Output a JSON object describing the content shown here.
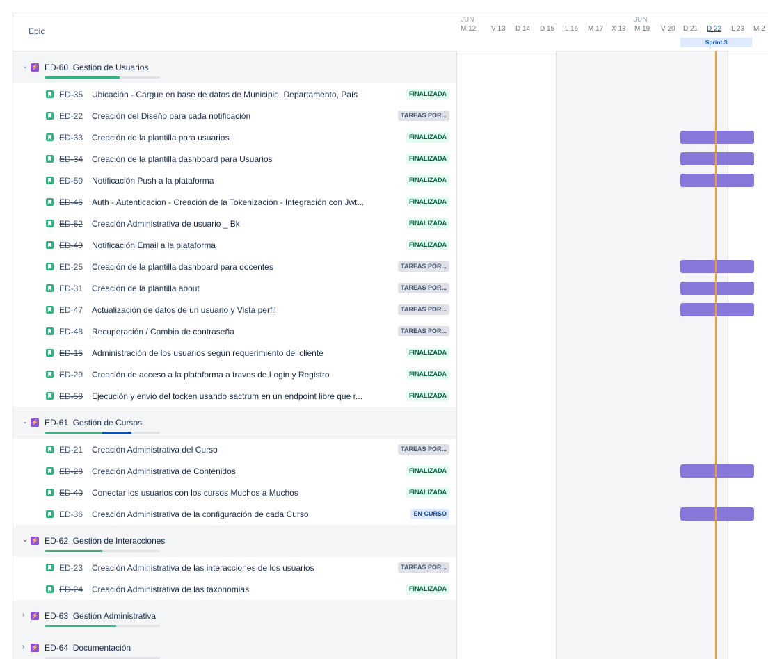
{
  "header": {
    "epic_label": "Epic",
    "months": [
      "JUN",
      "JUN"
    ],
    "days": [
      "M 12",
      "V 13",
      "D 14",
      "D 15",
      "L 16",
      "M 17",
      "X 18",
      "M 19",
      "V 20",
      "D 21",
      "D 22",
      "L 23",
      "M 2"
    ],
    "sprint": "Sprint 3"
  },
  "colors": {
    "epic": "#904ee2",
    "story": "#36b37e",
    "bar": "#8777d9",
    "today": "#ff991f",
    "progress_done": "#36b37e",
    "progress_inprogress": "#0052cc"
  },
  "rows": [
    {
      "type": "epic",
      "expanded": true,
      "key": "ED-60",
      "title": "Gestión de Usuarios",
      "progress": {
        "done": 0.65,
        "inprogress": 0
      }
    },
    {
      "type": "story",
      "key": "ED-35",
      "title": "Ubicación - Cargue en base de datos de Municipio, Departamento, País",
      "status": "FINALIZADA",
      "done": true,
      "bar": false
    },
    {
      "type": "story",
      "key": "ED-22",
      "title": "Creación del Diseño para cada notificación",
      "status": "TAREAS POR...",
      "done": false,
      "bar": false
    },
    {
      "type": "story",
      "key": "ED-33",
      "title": "Creación de la plantilla para usuarios",
      "status": "FINALIZADA",
      "done": true,
      "bar": true
    },
    {
      "type": "story",
      "key": "ED-34",
      "title": "Creación de la plantilla dashboard para Usuarios",
      "status": "FINALIZADA",
      "done": true,
      "bar": true
    },
    {
      "type": "story",
      "key": "ED-50",
      "title": "Notificación Push a la plataforma",
      "status": "FINALIZADA",
      "done": true,
      "bar": true
    },
    {
      "type": "story",
      "key": "ED-46",
      "title": "Auth - Autenticacion - Creación de la Tokenización - Integración con Jwt...",
      "status": "FINALIZADA",
      "done": true,
      "bar": false
    },
    {
      "type": "story",
      "key": "ED-52",
      "title": "Creación Administrativa de usuario _ Bk",
      "status": "FINALIZADA",
      "done": true,
      "bar": false
    },
    {
      "type": "story",
      "key": "ED-49",
      "title": "Notificación Email a la plataforma",
      "status": "FINALIZADA",
      "done": true,
      "bar": false
    },
    {
      "type": "story",
      "key": "ED-25",
      "title": "Creación de la plantilla dashboard para docentes",
      "status": "TAREAS POR...",
      "done": false,
      "bar": true
    },
    {
      "type": "story",
      "key": "ED-31",
      "title": "Creación de la plantilla about",
      "status": "TAREAS POR...",
      "done": false,
      "bar": true
    },
    {
      "type": "story",
      "key": "ED-47",
      "title": "Actualización de datos de un usuario y Vista perfil",
      "status": "TAREAS POR...",
      "done": false,
      "bar": true
    },
    {
      "type": "story",
      "key": "ED-48",
      "title": "Recuperación / Cambio de contraseña",
      "status": "TAREAS POR...",
      "done": false,
      "bar": false
    },
    {
      "type": "story",
      "key": "ED-15",
      "title": "Administración de los usuarios según requerimiento del cliente",
      "status": "FINALIZADA",
      "done": true,
      "bar": false
    },
    {
      "type": "story",
      "key": "ED-29",
      "title": "Creación de acceso a la plataforma a traves de Login y Registro",
      "status": "FINALIZADA",
      "done": true,
      "bar": false
    },
    {
      "type": "story",
      "key": "ED-58",
      "title": "Ejecución y envio del tocken usando sactrum en un endpoint libre que r...",
      "status": "FINALIZADA",
      "done": true,
      "bar": false
    },
    {
      "type": "epic",
      "expanded": true,
      "key": "ED-61",
      "title": "Gestión de Cursos",
      "progress": {
        "done": 0.5,
        "inprogress": 0.25
      }
    },
    {
      "type": "story",
      "key": "ED-21",
      "title": "Creación Administrativa del Curso",
      "status": "TAREAS POR...",
      "done": false,
      "bar": false
    },
    {
      "type": "story",
      "key": "ED-28",
      "title": "Creación Administrativa de Contenidos",
      "status": "FINALIZADA",
      "done": true,
      "bar": true
    },
    {
      "type": "story",
      "key": "ED-40",
      "title": "Conectar los usuarios con los cursos Muchos a Muchos",
      "status": "FINALIZADA",
      "done": true,
      "bar": false
    },
    {
      "type": "story",
      "key": "ED-36",
      "title": "Creación Administrativa de la configuración de cada Curso",
      "status": "EN CURSO",
      "done": false,
      "bar": true
    },
    {
      "type": "epic",
      "expanded": true,
      "key": "ED-62",
      "title": "Gestión de Interacciones",
      "progress": {
        "done": 0.5,
        "inprogress": 0
      }
    },
    {
      "type": "story",
      "key": "ED-23",
      "title": "Creación Administrativa de las interacciones de los usuarios",
      "status": "TAREAS POR...",
      "done": false,
      "bar": false
    },
    {
      "type": "story",
      "key": "ED-24",
      "title": "Creación Administrativa de las taxonomias",
      "status": "FINALIZADA",
      "done": true,
      "bar": false
    },
    {
      "type": "epic",
      "expanded": false,
      "key": "ED-63",
      "title": "Gestión Administrativa",
      "progress": {
        "done": 0.62,
        "inprogress": 0
      }
    },
    {
      "type": "epic",
      "expanded": false,
      "key": "ED-64",
      "title": "Documentación",
      "progress": {
        "done": 0,
        "inprogress": 0
      }
    }
  ]
}
